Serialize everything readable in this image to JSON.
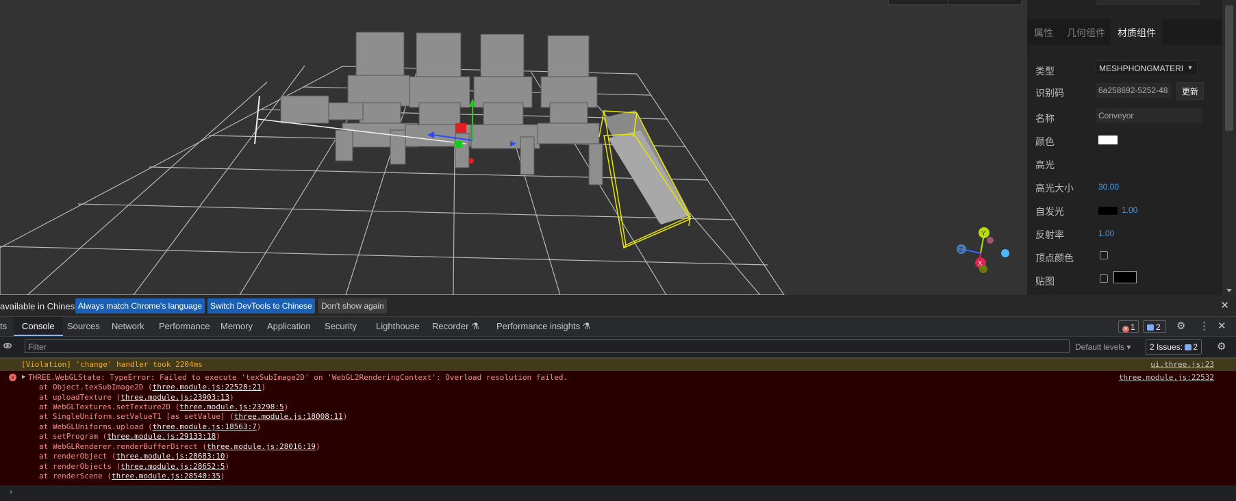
{
  "sidebar": {
    "tabs": [
      "属性",
      "几何组件",
      "材质组件"
    ],
    "rows": {
      "type_label": "类型",
      "type_value": "MESHPHONGMATERI",
      "uuid_label": "识别码",
      "uuid_value": "6a258692-5252-48",
      "uuid_button": "更新",
      "name_label": "名称",
      "name_value": "Conveyor",
      "color_label": "颜色",
      "specular_label": "高光",
      "shininess_label": "高光大小",
      "shininess_value": "30.00",
      "emissive_label": "自发光",
      "emissive_value": "1.00",
      "reflectivity_label": "反射率",
      "reflectivity_value": "1.00",
      "vertex_colors_label": "顶点颜色",
      "map_label": "贴图"
    },
    "colors": {
      "color": "#ffffff",
      "emissive": "#000000",
      "accent_number": "#3c9cf0"
    }
  },
  "viewport": {
    "gizmo": {
      "y": "Y",
      "z": "Z",
      "x": "X"
    },
    "colors": {
      "selection": "#e6e600",
      "grid": "#cfcfcf"
    }
  },
  "devtools": {
    "lang_bar": {
      "message": "available in Chinese!",
      "always_match": "Always match Chrome's language",
      "switch": "Switch DevTools to Chinese",
      "dont_show": "Don't show again"
    },
    "tabs": [
      "ts",
      "Console",
      "Sources",
      "Network",
      "Performance",
      "Memory",
      "Application",
      "Security",
      "Lighthouse",
      "Recorder",
      "Performance insights"
    ],
    "error_count": "1",
    "message_count": "2",
    "filter_placeholder": "Filter",
    "default_levels": "Default levels",
    "issues_label": "2 Issues:",
    "issues_count": "2",
    "violation": {
      "text": "[Violation] 'change' handler took 2204ms",
      "source": "ui.three.js:23"
    },
    "error": {
      "head": "THREE.WebGLState: TypeError: Failed to execute 'texSubImage2D' on 'WebGL2RenderingContext': Overload resolution failed.",
      "source": "three.module.js:22532",
      "stack": [
        {
          "fn": "at Object.texSubImage2D (",
          "link": "three.module.js:22528:21",
          "end": ")"
        },
        {
          "fn": "at uploadTexture (",
          "link": "three.module.js:23903:13",
          "end": ")"
        },
        {
          "fn": "at WebGLTextures.setTexture2D (",
          "link": "three.module.js:23298:5",
          "end": ")"
        },
        {
          "fn": "at SingleUniform.setValueT1 [as setValue] (",
          "link": "three.module.js:18008:11",
          "end": ")"
        },
        {
          "fn": "at WebGLUniforms.upload (",
          "link": "three.module.js:18563:7",
          "end": ")"
        },
        {
          "fn": "at setProgram (",
          "link": "three.module.js:29133:18",
          "end": ")"
        },
        {
          "fn": "at WebGLRenderer.renderBufferDirect (",
          "link": "three.module.js:28016:19",
          "end": ")"
        },
        {
          "fn": "at renderObject (",
          "link": "three.module.js:28683:10",
          "end": ")"
        },
        {
          "fn": "at renderObjects (",
          "link": "three.module.js:28652:5",
          "end": ")"
        },
        {
          "fn": "at renderScene (",
          "link": "three.module.js:28540:35",
          "end": ")"
        }
      ]
    },
    "prompt": "›"
  }
}
